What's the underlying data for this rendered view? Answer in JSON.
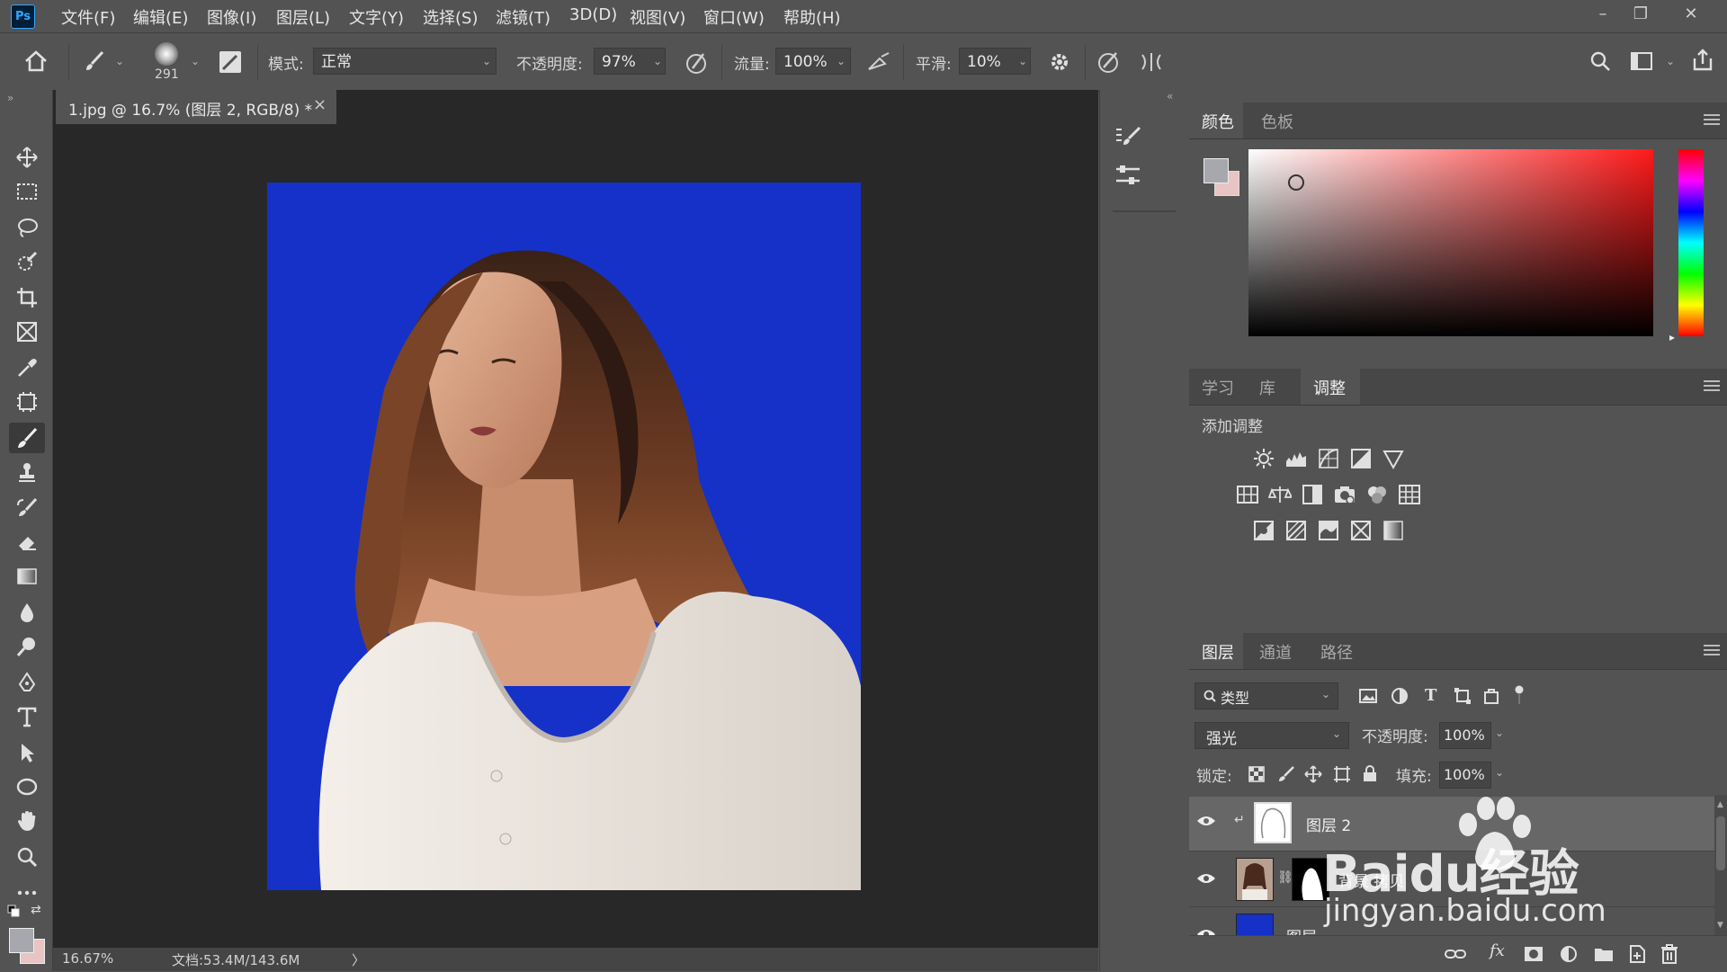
{
  "app": {
    "logo": "Ps"
  },
  "menu": [
    "文件(F)",
    "编辑(E)",
    "图像(I)",
    "图层(L)",
    "文字(Y)",
    "选择(S)",
    "滤镜(T)",
    "3D(D)",
    "视图(V)",
    "窗口(W)",
    "帮助(H)"
  ],
  "window_controls": {
    "minimize": "–",
    "restore": "❐",
    "close": "✕"
  },
  "options": {
    "brush_size": "291",
    "mode_label": "模式:",
    "mode_value": "正常",
    "opacity_label": "不透明度:",
    "opacity_value": "97%",
    "flow_label": "流量:",
    "flow_value": "100%",
    "smooth_label": "平滑:",
    "smooth_value": "10%"
  },
  "document": {
    "tab_title": "1.jpg @ 16.7% (图层 2, RGB/8) *",
    "tab_close": "×",
    "canvas_color": "#1531c8"
  },
  "status": {
    "zoom": "16.67%",
    "doc_info": "文档:53.4M/143.6M",
    "arrow": "〉"
  },
  "color_panel": {
    "tabs": [
      "颜色",
      "色板"
    ],
    "active_tab": "颜色",
    "foreground": "#a7a8ad",
    "background": "#e8c4c4",
    "hue_color": "#ff1a1a"
  },
  "adjust_panel": {
    "tabs": [
      "学习",
      "库",
      "调整"
    ],
    "active_tab": "调整",
    "heading": "添加调整"
  },
  "layers_panel": {
    "tabs": [
      "图层",
      "通道",
      "路径"
    ],
    "active_tab": "图层",
    "filter_label": "类型",
    "blend_mode": "强光",
    "opacity_label": "不透明度:",
    "opacity_value": "100%",
    "lock_label": "锁定:",
    "fill_label": "填充:",
    "fill_value": "100%",
    "layers": [
      {
        "name": "图层 2"
      },
      {
        "name": "背景 拷贝"
      },
      {
        "name": "图层"
      }
    ]
  },
  "watermark": {
    "brand": "Baidu经验",
    "url": "jingyan.baidu.com"
  }
}
